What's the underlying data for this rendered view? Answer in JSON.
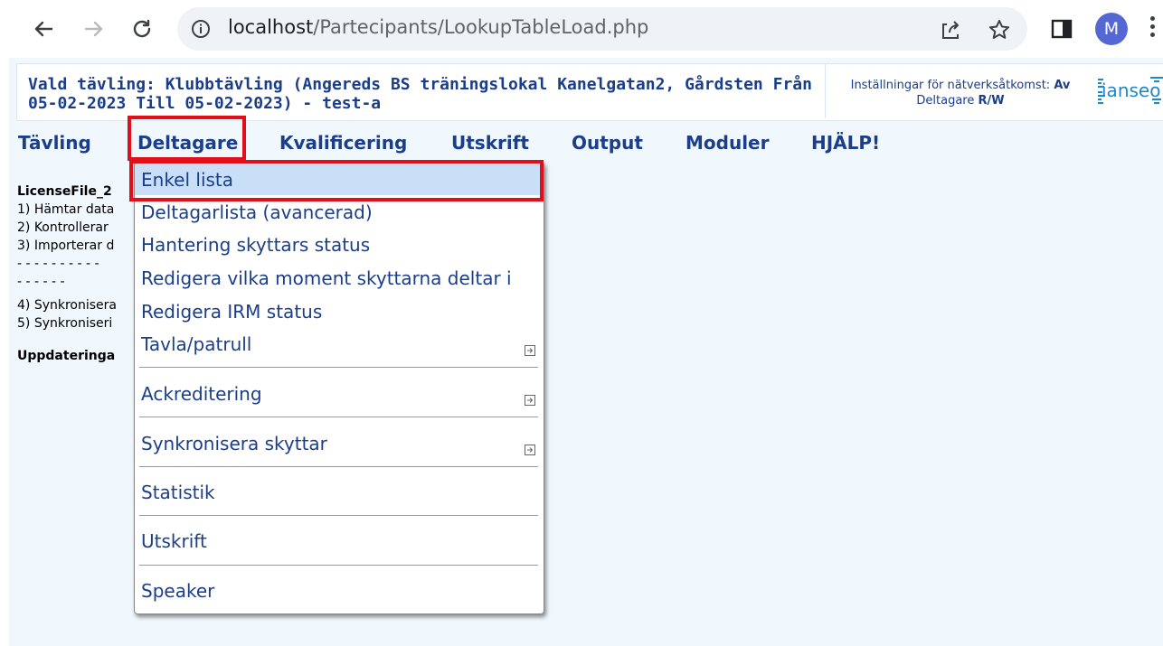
{
  "browser": {
    "url_host": "localhost",
    "url_path": "/Partecipants/LookupTableLoad.php",
    "profile_initial": "M",
    "icons": [
      "back-arrow-icon",
      "forward-arrow-icon",
      "reload-icon",
      "info-icon",
      "share-icon",
      "star-icon",
      "side-panel-icon",
      "more-vert-icon"
    ]
  },
  "header": {
    "competition_line1": "Vald tävling: Klubbtävling (Angereds BS träningslokal Kanelgatan2, Gårdsten Från",
    "competition_line2": "05-02-2023 Till 05-02-2023) - test-a",
    "settings_prefix": "Inställningar för nätverksåtkomst:",
    "settings_value": "Av",
    "participants_prefix": "Deltagare",
    "participants_value": "R/W",
    "logo_text": "ianseo"
  },
  "menu": {
    "items": [
      "Tävling",
      "Deltagare",
      "Kvalificering",
      "Utskrift",
      "Output",
      "Moduler",
      "HJÄLP!"
    ],
    "active": "Deltagare"
  },
  "content": {
    "title": "LicenseFile_2",
    "lines": [
      "1) Hämtar data",
      "2) Kontrollerar",
      "3) Importerar d",
      "- - - - - - - - - -",
      "- - - - - -",
      "4) Synkronisera",
      "5) Synkroniseri"
    ],
    "footer": "Uppdateringa"
  },
  "dropdown": {
    "items": [
      {
        "label": "Enkel lista",
        "selected": true
      },
      {
        "label": "Deltagarlista (avancerad)"
      },
      {
        "label": "Hantering skyttars status"
      },
      {
        "label": "Redigera vilka moment skyttarna deltar i"
      },
      {
        "label": "Redigera IRM status"
      },
      {
        "label": "Tavla/patrull",
        "submenu": true
      },
      {
        "label": "Ackreditering",
        "submenu": true
      },
      {
        "label": "Synkronisera skyttar",
        "submenu": true
      },
      {
        "label": "Statistik"
      },
      {
        "label": "Utskrift"
      },
      {
        "label": "Speaker"
      }
    ]
  },
  "colors": {
    "menu_text": "#1a3e8a",
    "page_bg": "#f0f7fd",
    "highlight": "#e0101b",
    "selected_bg": "#c8dff7",
    "avatar": "#5468d4"
  }
}
